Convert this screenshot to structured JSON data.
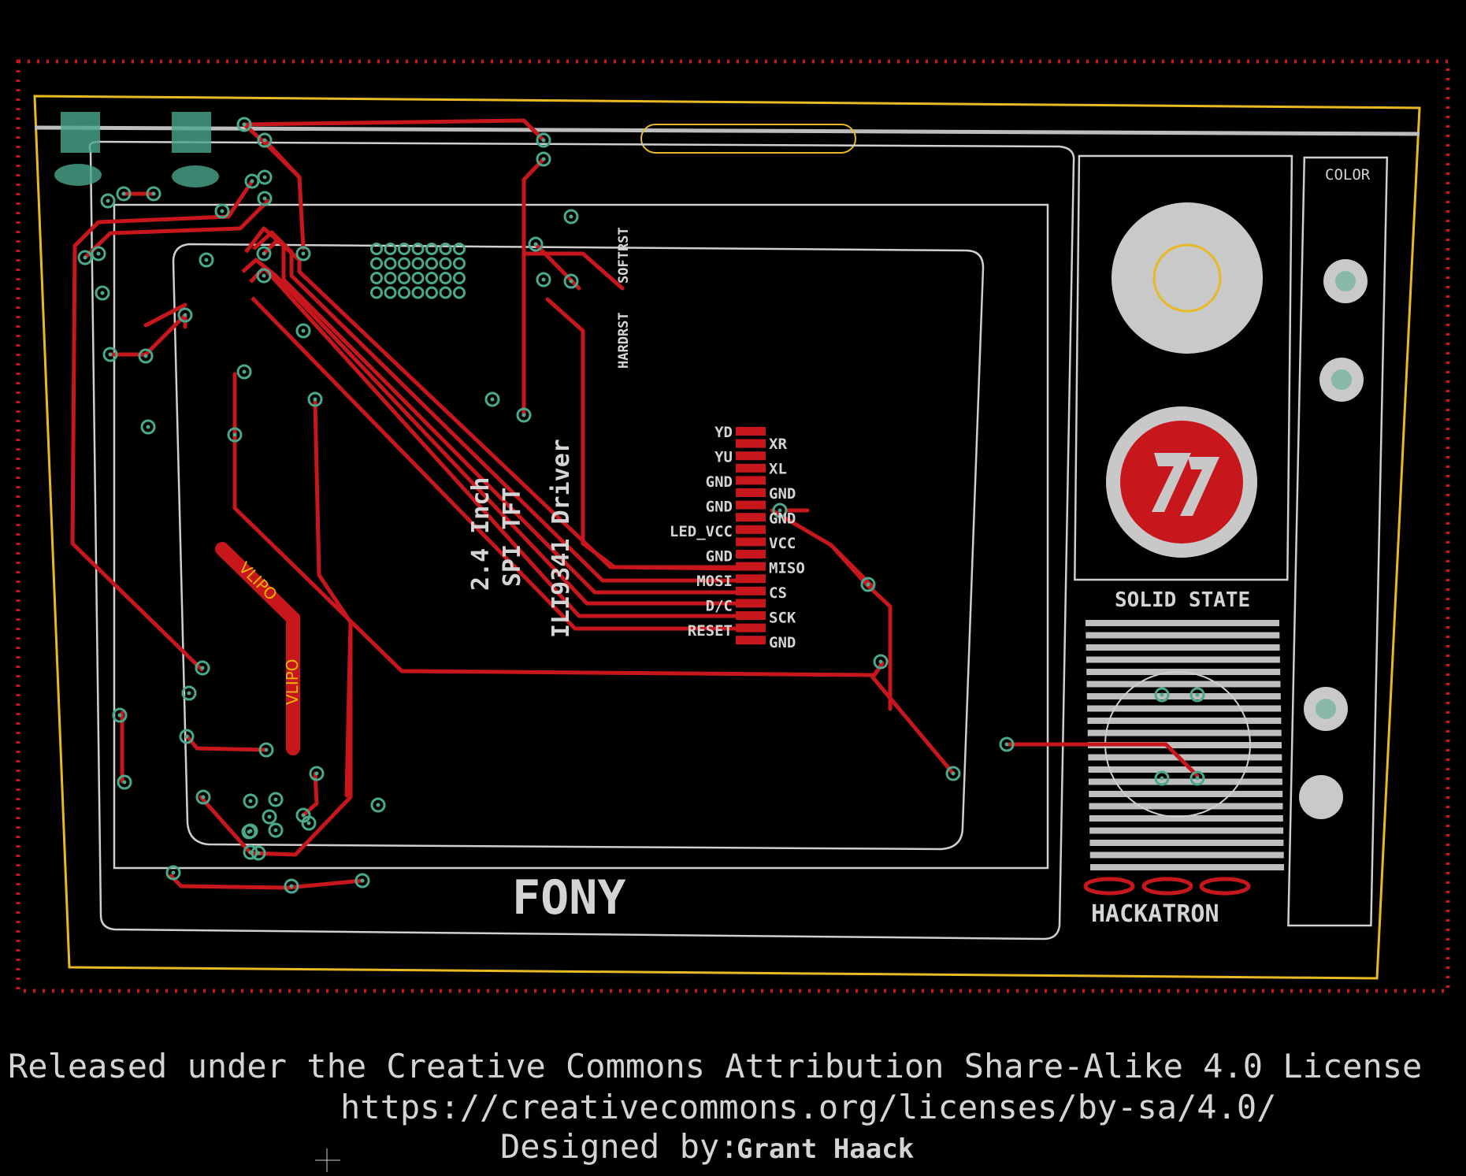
{
  "board": {
    "brand": "FONY",
    "panel_label": "SOLID STATE",
    "maker_label": "HACKATRON",
    "knob_label": "COLOR",
    "display_title": [
      "2.4 Inch",
      "SPI TFT",
      "ILI9341 Driver"
    ],
    "button_labels": [
      "HARDRST",
      "SOFTRST"
    ],
    "battery_label": "VLIPO",
    "pins_left": [
      "YD",
      "YU",
      "GND",
      "GND",
      "LED_VCC",
      "GND",
      "MOSI",
      "D/C",
      "RESET"
    ],
    "pins_right": [
      "XR",
      "XL",
      "GND",
      "GND",
      "VCC",
      "MISO",
      "CS",
      "SCK",
      "GND"
    ]
  },
  "footer": {
    "license": "Released under the Creative Commons Attribution Share-Alike 4.0 License",
    "url": "https://creativecommons.org/licenses/by-sa/4.0/",
    "designed_by_prefix": "Designed by:",
    "designer": "Grant Haack"
  },
  "colors": {
    "background": "#000000",
    "copper": "#c8161d",
    "silkscreen": "#d4d4d4",
    "outline": "#e8b923",
    "pad": "#4aa88c"
  }
}
